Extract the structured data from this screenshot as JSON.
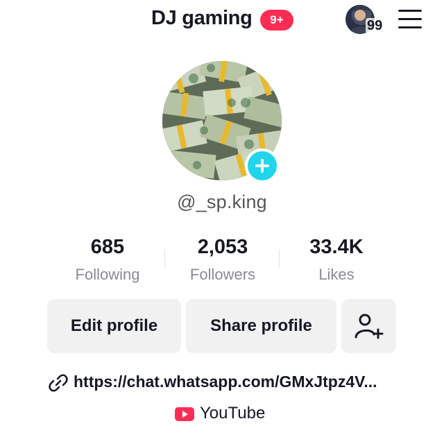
{
  "header": {
    "title": "DJ gaming",
    "notification_badge": "9+",
    "account_switcher_count": "99",
    "menu_icon": "hamburger-menu-icon"
  },
  "profile": {
    "avatar_icon": "profile-photo",
    "add_avatar_icon": "plus-icon",
    "username": "@_sp.king"
  },
  "stats": [
    {
      "value": "685",
      "label": "Following"
    },
    {
      "value": "2,053",
      "label": "Followers"
    },
    {
      "value": "33.4K",
      "label": "Likes"
    }
  ],
  "actions": {
    "edit_profile": "Edit profile",
    "share_profile": "Share profile",
    "add_friends_icon": "add-user-icon"
  },
  "bio": {
    "link_icon": "link-icon",
    "link": "https://chat.whatsapp.com/GMxJtpz4V...",
    "youtube_icon": "youtube-icon",
    "youtube_label": "YouTube"
  },
  "colors": {
    "accent_red": "#fe2c55",
    "add_button_cyan": "#20d5ec",
    "button_bg": "#f1f1f2",
    "text_primary": "#161823",
    "text_secondary": "#8a8b91"
  }
}
